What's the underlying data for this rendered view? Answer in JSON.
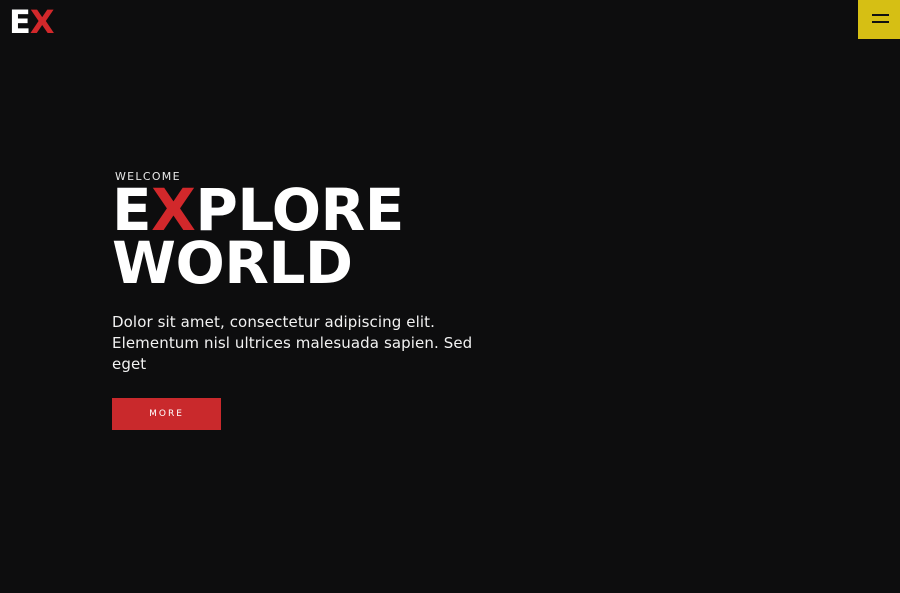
{
  "header": {
    "logo": {
      "accent_text": "",
      "first": "E",
      "second": "X"
    },
    "menu_icon": "hamburger-menu-icon"
  },
  "hero": {
    "eyebrow": "WELCOME",
    "headline": {
      "line1_start": "E",
      "line1_accent": "X",
      "line1_end": "PLORE",
      "line2": "WORLD"
    },
    "body": "Dolor sit amet, consectetur adipiscing elit. Elementum nisl ultrices malesuada sapien. Sed eget",
    "button_label": "MORE"
  },
  "colors": {
    "background": "#0d0d0e",
    "accent_red": "#d2282b",
    "menu_yellow": "#d6bf14",
    "text": "#ffffff"
  }
}
